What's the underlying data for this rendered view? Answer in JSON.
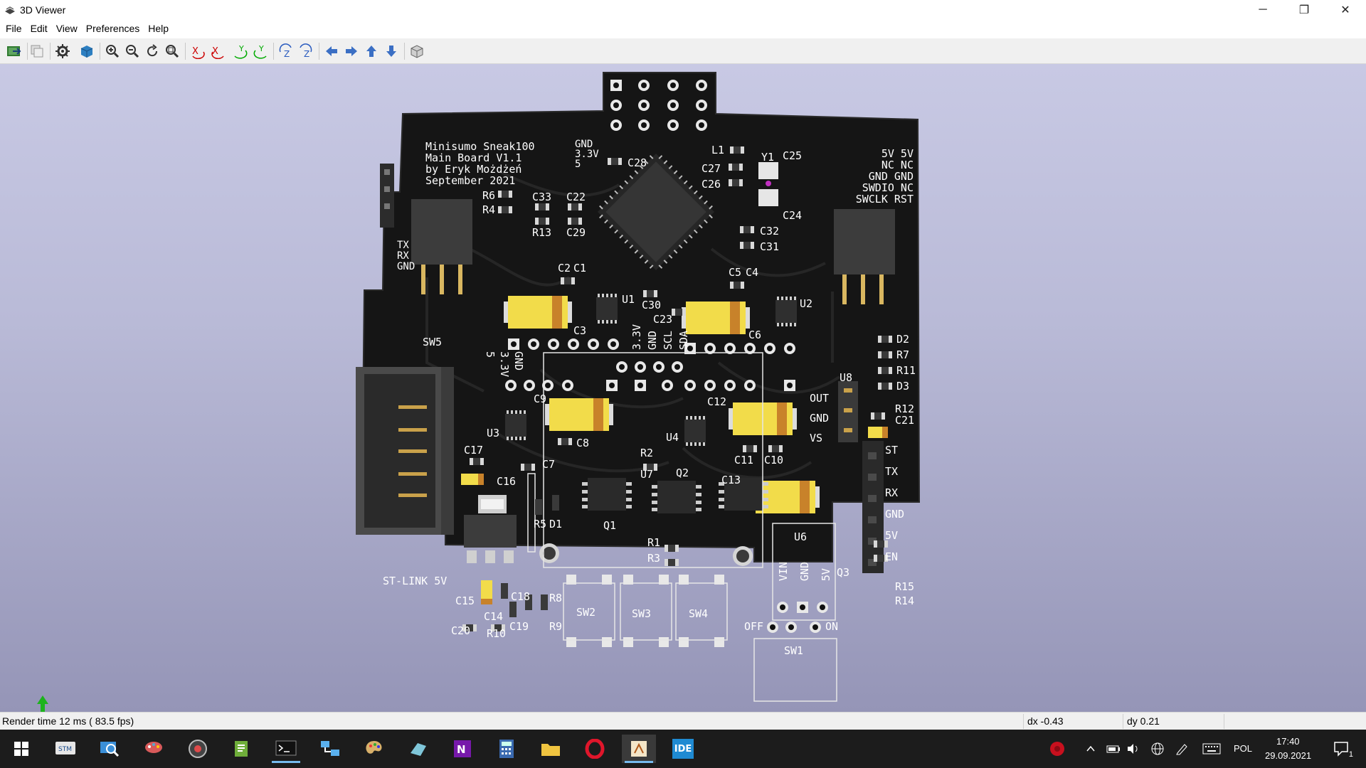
{
  "window": {
    "title": "3D Viewer",
    "minimize_glyph": "─",
    "maximize_glyph": "❐",
    "close_glyph": "✕"
  },
  "menu": {
    "items": [
      "File",
      "Edit",
      "View",
      "Preferences",
      "Help"
    ]
  },
  "toolbar": {
    "buttons": [
      "reload-board-icon",
      "copy-image-icon",
      "render-options-icon",
      "raytracing-icon",
      "zoom-in-icon",
      "zoom-out-icon",
      "redraw-icon",
      "zoom-fit-icon",
      "rotate-x-cw-icon",
      "rotate-x-ccw-icon",
      "rotate-y-cw-icon",
      "rotate-y-ccw-icon",
      "rotate-z-cw-icon",
      "rotate-z-ccw-icon",
      "move-left-icon",
      "move-right-icon",
      "move-up-icon",
      "move-down-icon",
      "orthographic-icon"
    ]
  },
  "board": {
    "silkscreen_title": [
      "Minisumo Sneak100",
      "Main Board V1.1",
      "by Eryk Możdżeń",
      "September 2021"
    ],
    "labels": {
      "gnd_33v_5": [
        "GND",
        "3.3V",
        "5"
      ],
      "swd_header": [
        "5V 5V",
        "NC NC",
        "GND GND",
        "SWDIO NC",
        "SWCLK RST"
      ],
      "uart": [
        "TX",
        "RX",
        "GND"
      ],
      "sensor_pins": [
        "OUT",
        "GND",
        "VS"
      ],
      "connector_pins": [
        "ST",
        "TX",
        "RX",
        "GND",
        "5V",
        "EN"
      ],
      "power_pins": [
        "VIN",
        "GND",
        "5V"
      ],
      "switch_state": [
        "OFF",
        "ON"
      ],
      "i2c_pins": [
        "3.3V",
        "GND",
        "SCL",
        "SDA"
      ],
      "rot_pins": [
        "5",
        "3.3V",
        "GND"
      ],
      "stlink": "ST-LINK 5V"
    },
    "refdes": [
      "C28",
      "C25",
      "Y1",
      "L1",
      "C27",
      "C26",
      "C24",
      "C33",
      "C22",
      "R6",
      "R4",
      "R13",
      "C29",
      "C32",
      "C31",
      "C2",
      "C1",
      "C5",
      "C4",
      "U1",
      "U2",
      "C30",
      "C23",
      "C3",
      "C6",
      "SW5",
      "D2",
      "R7",
      "R11",
      "D3",
      "U8",
      "R12",
      "C21",
      "C9",
      "C12",
      "U3",
      "U4",
      "C8",
      "C11",
      "C10",
      "C17",
      "C16",
      "C7",
      "R2",
      "U7",
      "Q2",
      "C13",
      "R5",
      "D1",
      "Q1",
      "R1",
      "R3",
      "U6",
      "Q3",
      "R15",
      "R14",
      "C15",
      "C14",
      "C18",
      "R8",
      "C20",
      "R10",
      "C19",
      "R9",
      "SW2",
      "SW3",
      "SW4",
      "SW1"
    ]
  },
  "status": {
    "render_time": "Render time 12 ms ( 83.5 fps)",
    "dx": "dx -0.43",
    "dy": "dy 0.21"
  },
  "taskbar": {
    "apps": [
      "stm32cube-icon",
      "search-icon",
      "paint-icon",
      "media-icon",
      "notepad-icon",
      "terminal-icon",
      "network-icon",
      "palette-icon",
      "eraser-icon",
      "onenote-icon",
      "calculator-icon",
      "folder-icon",
      "opera-icon",
      "kicad-icon",
      "ide-icon"
    ],
    "ide_label": "IDE",
    "language": "POL",
    "time": "17:40",
    "date": "29.09.2021",
    "notification_count": "1"
  },
  "colors": {
    "viewport_top": "#c8c9e4",
    "viewport_bottom": "#9595b7",
    "pcb": "#141414",
    "silkscreen": "#ffffff",
    "capacitor_tantalum": "#f2dc4a",
    "capacitor_band": "#c8822a"
  }
}
